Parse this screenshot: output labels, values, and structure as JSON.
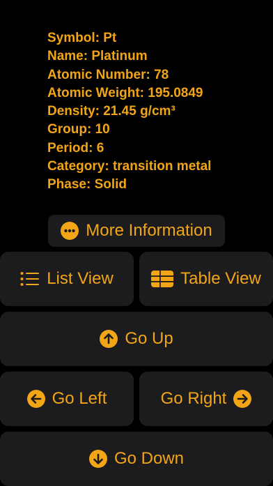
{
  "element": {
    "symbol": "Symbol: Pt",
    "name": "Name: Platinum",
    "atomic_number": "Atomic Number: 78",
    "atomic_weight": "Atomic Weight: 195.0849",
    "density": "Density: 21.45 g/cm³",
    "group": "Group: 10",
    "period": "Period: 6",
    "category": "Category: transition metal",
    "phase": "Phase: Solid"
  },
  "buttons": {
    "more_info": {
      "label": "More Information",
      "icon": "ellipsis-circle-icon"
    },
    "list_view": {
      "label": "List View",
      "icon": "list-icon"
    },
    "table_view": {
      "label": "Table View",
      "icon": "table-icon"
    },
    "go_up": {
      "label": "Go Up",
      "icon": "arrow-up-circle-icon"
    },
    "go_left": {
      "label": "Go Left",
      "icon": "arrow-left-circle-icon"
    },
    "go_right": {
      "label": "Go Right",
      "icon": "arrow-right-circle-icon"
    },
    "go_down": {
      "label": "Go Down",
      "icon": "arrow-down-circle-icon"
    }
  },
  "colors": {
    "background": "#000000",
    "button_background": "#1C1C1E",
    "accent": "#F2A516"
  }
}
